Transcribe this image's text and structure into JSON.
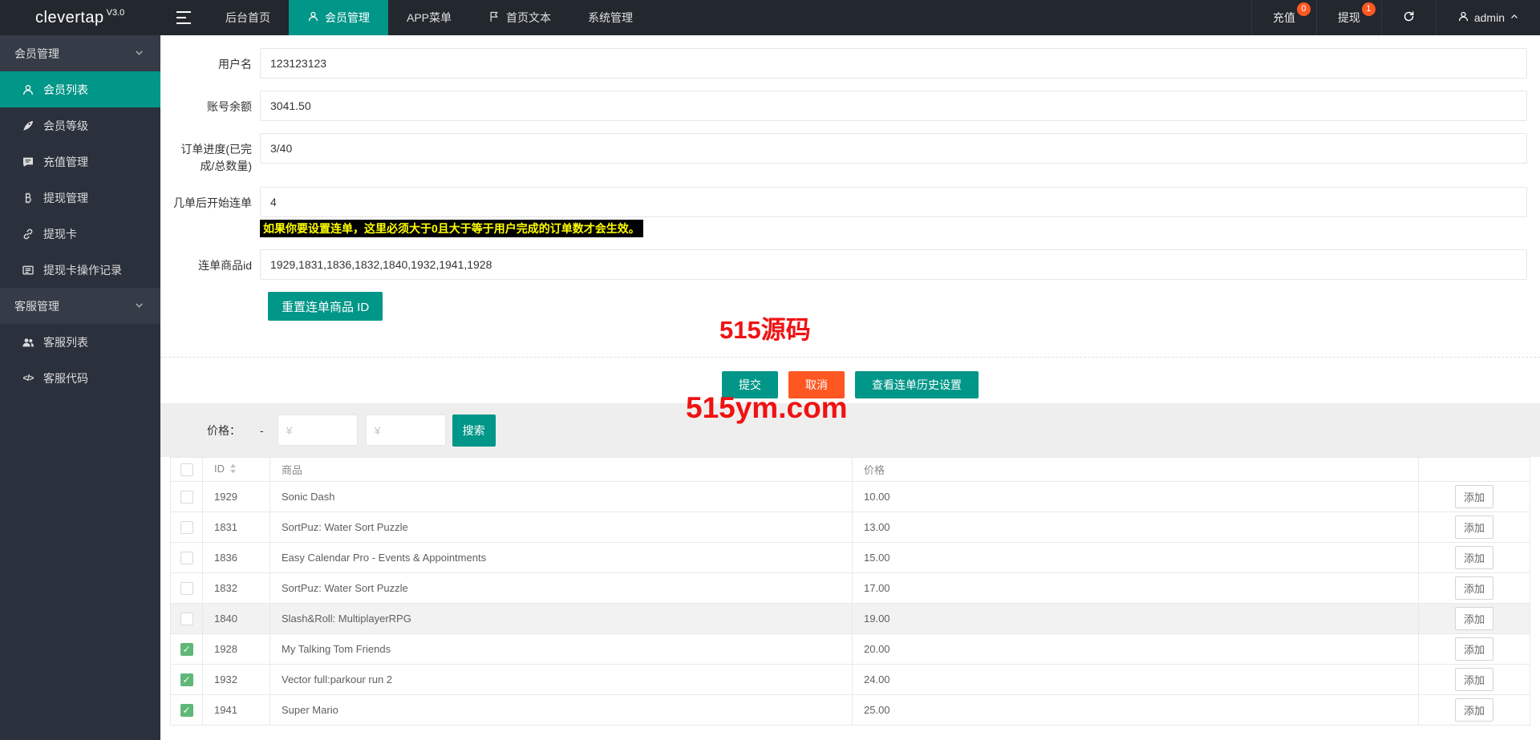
{
  "navbar": {
    "logo_text": "clevertap",
    "logo_version": "V3.0",
    "tabs": [
      {
        "label": "后台首页",
        "active": false
      },
      {
        "label": "会员管理",
        "active": true,
        "icon": "user-icon"
      },
      {
        "label": "APP菜单",
        "active": false
      },
      {
        "label": "首页文本",
        "active": false,
        "icon": "flag-icon"
      },
      {
        "label": "系统管理",
        "active": false
      }
    ],
    "recharge": {
      "label": "充值",
      "badge": "0"
    },
    "withdraw": {
      "label": "提现",
      "badge": "1"
    },
    "user": "admin"
  },
  "sidebar": {
    "items": [
      {
        "type": "group",
        "label": "会员管理",
        "icon": "chevron-down-icon"
      },
      {
        "type": "item",
        "label": "会员列表",
        "icon": "user-icon",
        "active": true
      },
      {
        "type": "item",
        "label": "会员等级",
        "icon": "rocket-icon"
      },
      {
        "type": "item",
        "label": "充值管理",
        "icon": "chat-icon"
      },
      {
        "type": "item",
        "label": "提现管理",
        "icon": "bitcoin-icon"
      },
      {
        "type": "item",
        "label": "提现卡",
        "icon": "link-icon"
      },
      {
        "type": "item",
        "label": "提现卡操作记录",
        "icon": "list-icon"
      },
      {
        "type": "group",
        "label": "客服管理",
        "icon": "chevron-down-icon"
      },
      {
        "type": "item",
        "label": "客服列表",
        "icon": "users-icon"
      },
      {
        "type": "item",
        "label": "客服代码",
        "icon": "code-icon"
      }
    ]
  },
  "form": {
    "fields": [
      {
        "label": "用户名",
        "value": "123123123"
      },
      {
        "label": "账号余额",
        "value": "3041.50"
      },
      {
        "label": "订单进度(已完成/总数量)",
        "value": "3/40"
      },
      {
        "label": "几单后开始连单",
        "value": "4",
        "hint": "如果你要设置连单，这里必须大于0且大于等于用户完成的订单数才会生效。"
      },
      {
        "label": "连单商品id",
        "value": "1929,1831,1836,1832,1840,1932,1941,1928"
      }
    ],
    "reset_label": "重置连单商品 ID",
    "submit_label": "提交",
    "cancel_label": "取消",
    "history_label": "查看连单历史设置"
  },
  "filter": {
    "label": "价格：",
    "dash": "-",
    "min_placeholder": "¥",
    "max_placeholder": "¥",
    "search_label": "搜索"
  },
  "table": {
    "headers": {
      "id": "ID",
      "product": "商品",
      "price": "价格"
    },
    "add_label": "添加",
    "rows": [
      {
        "id": "1929",
        "product": "Sonic Dash",
        "price": "10.00",
        "checked": false,
        "highlight": false
      },
      {
        "id": "1831",
        "product": "SortPuz: Water Sort Puzzle",
        "price": "13.00",
        "checked": false,
        "highlight": false
      },
      {
        "id": "1836",
        "product": "Easy Calendar Pro - Events & Appointments",
        "price": "15.00",
        "checked": false,
        "highlight": false
      },
      {
        "id": "1832",
        "product": "SortPuz: Water Sort Puzzle",
        "price": "17.00",
        "checked": false,
        "highlight": false
      },
      {
        "id": "1840",
        "product": "Slash&Roll: MultiplayerRPG",
        "price": "19.00",
        "checked": false,
        "highlight": true
      },
      {
        "id": "1928",
        "product": "My Talking Tom Friends",
        "price": "20.00",
        "checked": true,
        "highlight": false
      },
      {
        "id": "1932",
        "product": "Vector full:parkour run 2",
        "price": "24.00",
        "checked": true,
        "highlight": false
      },
      {
        "id": "1941",
        "product": "Super Mario",
        "price": "25.00",
        "checked": true,
        "highlight": false
      }
    ]
  },
  "watermarks": {
    "top": "515源码",
    "bottom": "515ym.com"
  },
  "colors": {
    "accent_teal": "#009688",
    "cancel_orange": "#ff5722",
    "badge_orange": "#ff5722",
    "watermark_red": "#f01212",
    "checkbox_green": "#5FB878",
    "hint_bg": "#000000",
    "hint_fg": "#ffff00"
  }
}
